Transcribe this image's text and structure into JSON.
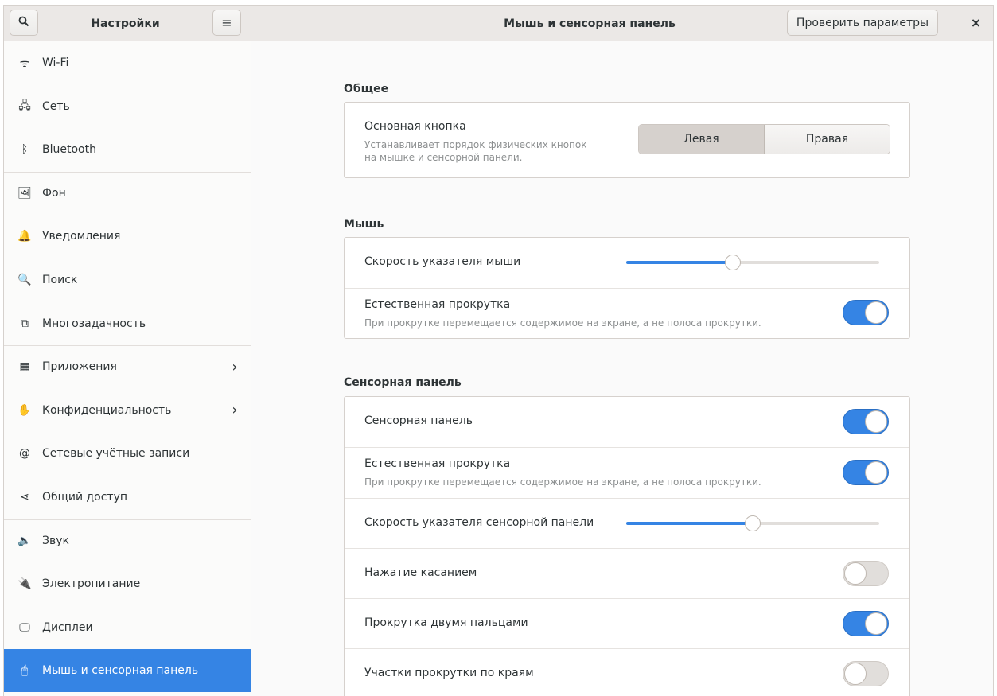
{
  "header": {
    "app_title": "Настройки",
    "panel_title": "Мышь и сенсорная панель",
    "test_button": "Проверить параметры",
    "search_icon": "search-icon",
    "menu_icon": "hamburger-menu-icon",
    "close_icon": "close-icon",
    "glyphs": {
      "search": "🔍",
      "menu": "≡",
      "close": "×"
    }
  },
  "sidebar": {
    "items": [
      {
        "label": "Wi-Fi",
        "icon": "wifi-icon",
        "glyph": "ᯤ"
      },
      {
        "label": "Сеть",
        "icon": "network-icon",
        "glyph": "🖧"
      },
      {
        "label": "Bluetooth",
        "icon": "bluetooth-icon",
        "glyph": "ᛒ"
      },
      {
        "label": "Фон",
        "icon": "background-icon",
        "glyph": "🖼"
      },
      {
        "label": "Уведомления",
        "icon": "bell-icon",
        "glyph": "🔔"
      },
      {
        "label": "Поиск",
        "icon": "search-icon",
        "glyph": "🔍"
      },
      {
        "label": "Многозадачность",
        "icon": "multitasking-icon",
        "glyph": "⧉"
      },
      {
        "label": "Приложения",
        "icon": "apps-icon",
        "glyph": "▦",
        "chevron": "›"
      },
      {
        "label": "Конфиденциальность",
        "icon": "hand-icon",
        "glyph": "✋",
        "chevron": "›"
      },
      {
        "label": "Сетевые учётные записи",
        "icon": "at-icon",
        "glyph": "@"
      },
      {
        "label": "Общий доступ",
        "icon": "share-icon",
        "glyph": "⋖"
      },
      {
        "label": "Звук",
        "icon": "speaker-icon",
        "glyph": "🔈"
      },
      {
        "label": "Электропитание",
        "icon": "power-icon",
        "glyph": "🔌"
      },
      {
        "label": "Дисплеи",
        "icon": "display-icon",
        "glyph": "🖵"
      },
      {
        "label": "Мышь и сенсорная панель",
        "icon": "mouse-icon",
        "glyph": "🖱",
        "active": true
      }
    ]
  },
  "general": {
    "title": "Общее",
    "primary_button": {
      "label": "Основная кнопка",
      "description_line1": "Устанавливает порядок физических кнопок",
      "description_line2": "на мышке и сенсорной панели.",
      "options": [
        "Левая",
        "Правая"
      ],
      "selected": "Левая"
    }
  },
  "mouse": {
    "title": "Мышь",
    "speed": {
      "label": "Скорость указателя мыши",
      "value": 0.42
    },
    "natural_scroll": {
      "label": "Естественная прокрутка",
      "description": "При прокрутке перемещается содержимое на экране, а не полоса прокрутки.",
      "enabled": true
    }
  },
  "touchpad": {
    "title": "Сенсорная панель",
    "enabled": {
      "label": "Сенсорная панель",
      "on": true
    },
    "natural_scroll": {
      "label": "Естественная прокрутка",
      "description": "При прокрутке перемещается содержимое на экране, а не полоса прокрутки.",
      "on": true
    },
    "speed": {
      "label": "Скорость указателя сенсорной панели",
      "value": 0.5
    },
    "tap_to_click": {
      "label": "Нажатие касанием",
      "on": false
    },
    "two_finger_scroll": {
      "label": "Прокрутка двумя пальцами",
      "on": true
    },
    "edge_scroll": {
      "label": "Участки прокрутки по краям",
      "on": false
    }
  },
  "colors": {
    "accent": "#3584e4",
    "headerbar": "#ebe8e6",
    "sidebar_bg": "#fbfbfa",
    "content_bg": "#fafafa"
  }
}
